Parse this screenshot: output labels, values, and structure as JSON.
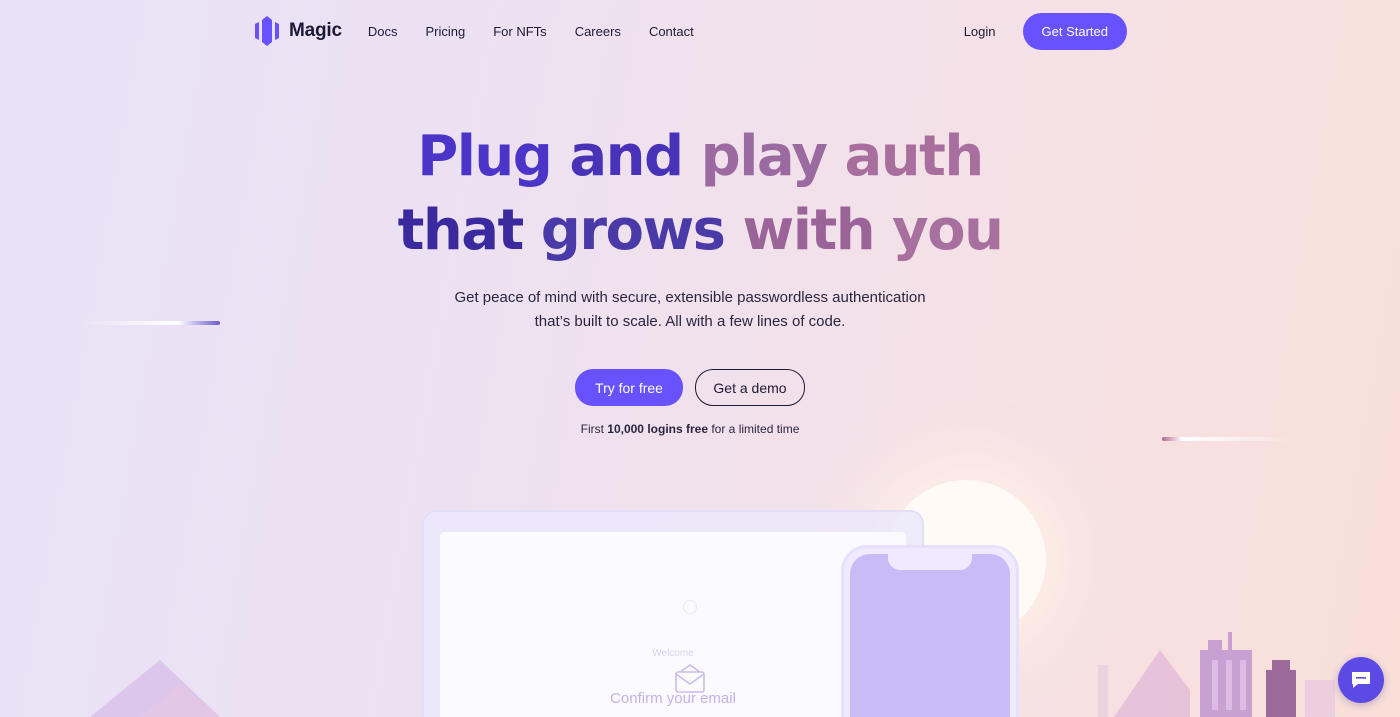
{
  "nav": {
    "brand": "Magic",
    "links": [
      "Docs",
      "Pricing",
      "For NFTs",
      "Careers",
      "Contact"
    ],
    "login": "Login",
    "cta": "Get Started"
  },
  "hero": {
    "title_line1": [
      "Plug",
      "and",
      "play",
      "auth"
    ],
    "title_line2": [
      "that",
      "grows",
      "with",
      "you"
    ],
    "subtitle": "Get peace of mind with secure, extensible passwordless authentication that’s built to scale. All with a few lines of code.",
    "primary_cta": "Try for free",
    "secondary_cta": "Get a demo",
    "fine_print": {
      "prefix": "First",
      "emphasis": "10,000 logins free",
      "suffix": "for a limited time"
    }
  },
  "illustration": {
    "welcome": "Welcome",
    "confirm": "Confirm your email"
  },
  "colors": {
    "accent": "#6851ff",
    "text_dark": "#1d1a35",
    "title_purple": "#4b35c9",
    "title_pink": "#a86e9e"
  },
  "icons": {
    "logo": "magic-logo-icon",
    "envelope": "envelope-icon",
    "chat": "chat-bubble-icon"
  }
}
